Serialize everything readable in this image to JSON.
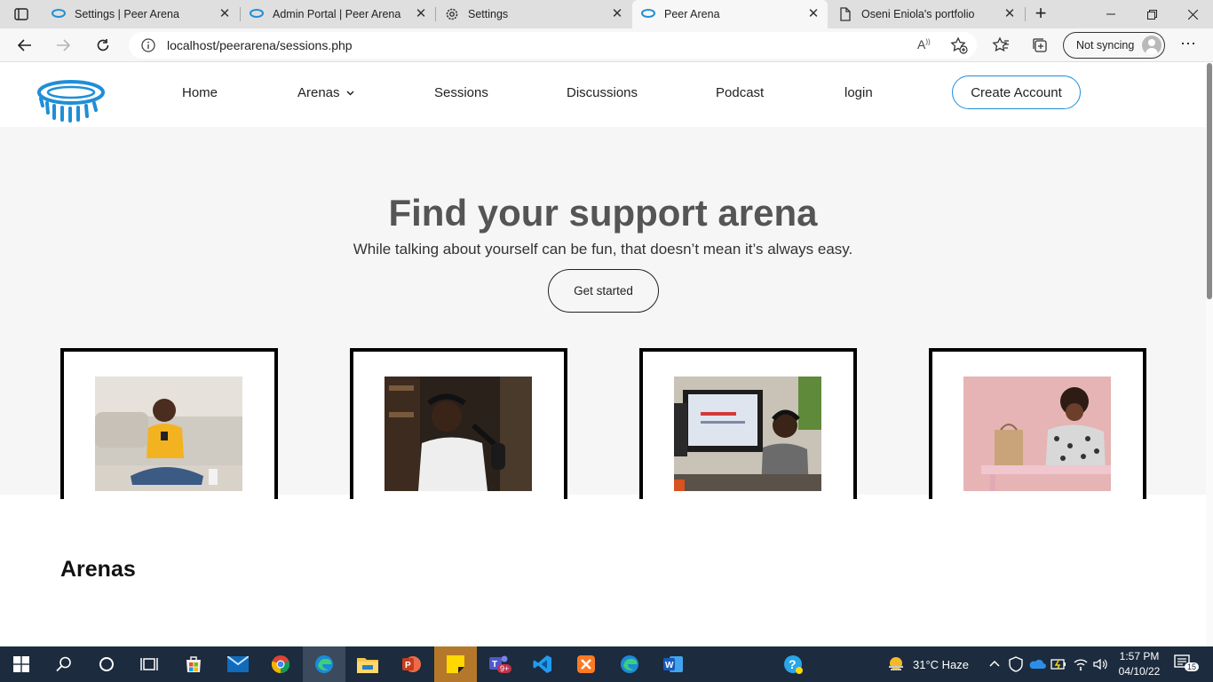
{
  "browser": {
    "tabs": [
      {
        "title": "Settings | Peer Arena",
        "icon": "peer-arena-favicon",
        "active": false
      },
      {
        "title": "Admin Portal | Peer Arena",
        "icon": "peer-arena-favicon",
        "active": false
      },
      {
        "title": "Settings",
        "icon": "gear-icon",
        "active": false
      },
      {
        "title": "Peer Arena",
        "icon": "peer-arena-favicon",
        "active": true
      },
      {
        "title": "Oseni Eniola's portfolio",
        "icon": "page-icon",
        "active": false
      }
    ],
    "url": "localhost/peerarena/sessions.php",
    "sync_label": "Not syncing"
  },
  "site": {
    "brand_color": "#1f8fd6",
    "nav": {
      "home": "Home",
      "arenas": "Arenas",
      "sessions": "Sessions",
      "discussions": "Discussions",
      "podcast": "Podcast",
      "login": "login",
      "create_account": "Create Account"
    },
    "hero": {
      "title": "Find your support arena",
      "subtitle": "While talking about yourself can be fun, that doesn’t mean it’s always easy.",
      "cta": "Get started"
    },
    "cards": [
      {
        "image": "woman-on-phone-photo"
      },
      {
        "image": "man-podcasting-photo"
      },
      {
        "image": "boy-at-computer-photo"
      },
      {
        "image": "woman-thinking-photo"
      }
    ],
    "arenas_heading": "Arenas"
  },
  "taskbar": {
    "weather": "31°C  Haze",
    "time": "1:57 PM",
    "date": "04/10/22",
    "notifications": "15",
    "teams_badge": "9+"
  }
}
